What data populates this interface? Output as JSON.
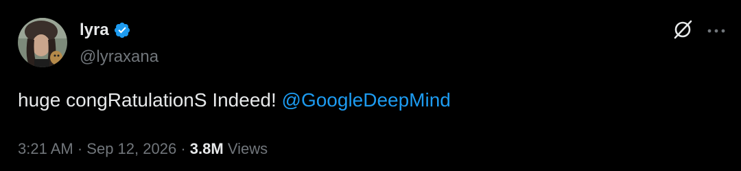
{
  "author": {
    "display_name": "lyra",
    "handle": "@lyraxana",
    "verified": true
  },
  "tweet": {
    "text": "huge congRatulationS Indeed!",
    "mention": "@GoogleDeepMind"
  },
  "meta": {
    "time": "3:21 AM",
    "separator1": "·",
    "date": "Sep 12, 2026",
    "separator2": "·",
    "views_count": "3.8M",
    "views_label": "Views"
  },
  "icons": {
    "verified": "verified-badge-icon",
    "grok": "grok-icon",
    "more": "more-icon"
  },
  "colors": {
    "background": "#000000",
    "primary_text": "#e7e9ea",
    "secondary_text": "#71767b",
    "accent": "#1d9bf0"
  }
}
